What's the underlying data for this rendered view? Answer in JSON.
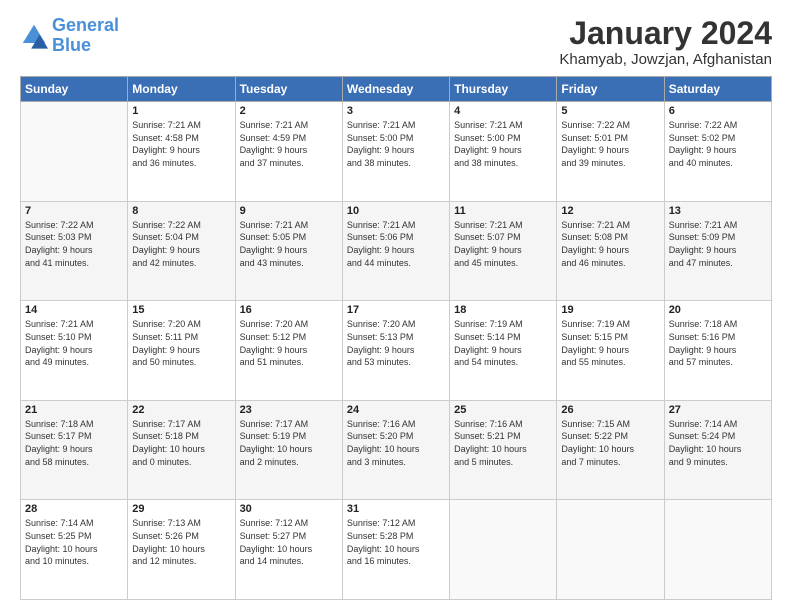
{
  "header": {
    "logo_general": "General",
    "logo_blue": "Blue",
    "title": "January 2024",
    "subtitle": "Khamyab, Jowzjan, Afghanistan"
  },
  "weekdays": [
    "Sunday",
    "Monday",
    "Tuesday",
    "Wednesday",
    "Thursday",
    "Friday",
    "Saturday"
  ],
  "weeks": [
    [
      {
        "day": "",
        "info": ""
      },
      {
        "day": "1",
        "info": "Sunrise: 7:21 AM\nSunset: 4:58 PM\nDaylight: 9 hours\nand 36 minutes."
      },
      {
        "day": "2",
        "info": "Sunrise: 7:21 AM\nSunset: 4:59 PM\nDaylight: 9 hours\nand 37 minutes."
      },
      {
        "day": "3",
        "info": "Sunrise: 7:21 AM\nSunset: 5:00 PM\nDaylight: 9 hours\nand 38 minutes."
      },
      {
        "day": "4",
        "info": "Sunrise: 7:21 AM\nSunset: 5:00 PM\nDaylight: 9 hours\nand 38 minutes."
      },
      {
        "day": "5",
        "info": "Sunrise: 7:22 AM\nSunset: 5:01 PM\nDaylight: 9 hours\nand 39 minutes."
      },
      {
        "day": "6",
        "info": "Sunrise: 7:22 AM\nSunset: 5:02 PM\nDaylight: 9 hours\nand 40 minutes."
      }
    ],
    [
      {
        "day": "7",
        "info": "Sunrise: 7:22 AM\nSunset: 5:03 PM\nDaylight: 9 hours\nand 41 minutes."
      },
      {
        "day": "8",
        "info": "Sunrise: 7:22 AM\nSunset: 5:04 PM\nDaylight: 9 hours\nand 42 minutes."
      },
      {
        "day": "9",
        "info": "Sunrise: 7:21 AM\nSunset: 5:05 PM\nDaylight: 9 hours\nand 43 minutes."
      },
      {
        "day": "10",
        "info": "Sunrise: 7:21 AM\nSunset: 5:06 PM\nDaylight: 9 hours\nand 44 minutes."
      },
      {
        "day": "11",
        "info": "Sunrise: 7:21 AM\nSunset: 5:07 PM\nDaylight: 9 hours\nand 45 minutes."
      },
      {
        "day": "12",
        "info": "Sunrise: 7:21 AM\nSunset: 5:08 PM\nDaylight: 9 hours\nand 46 minutes."
      },
      {
        "day": "13",
        "info": "Sunrise: 7:21 AM\nSunset: 5:09 PM\nDaylight: 9 hours\nand 47 minutes."
      }
    ],
    [
      {
        "day": "14",
        "info": "Sunrise: 7:21 AM\nSunset: 5:10 PM\nDaylight: 9 hours\nand 49 minutes."
      },
      {
        "day": "15",
        "info": "Sunrise: 7:20 AM\nSunset: 5:11 PM\nDaylight: 9 hours\nand 50 minutes."
      },
      {
        "day": "16",
        "info": "Sunrise: 7:20 AM\nSunset: 5:12 PM\nDaylight: 9 hours\nand 51 minutes."
      },
      {
        "day": "17",
        "info": "Sunrise: 7:20 AM\nSunset: 5:13 PM\nDaylight: 9 hours\nand 53 minutes."
      },
      {
        "day": "18",
        "info": "Sunrise: 7:19 AM\nSunset: 5:14 PM\nDaylight: 9 hours\nand 54 minutes."
      },
      {
        "day": "19",
        "info": "Sunrise: 7:19 AM\nSunset: 5:15 PM\nDaylight: 9 hours\nand 55 minutes."
      },
      {
        "day": "20",
        "info": "Sunrise: 7:18 AM\nSunset: 5:16 PM\nDaylight: 9 hours\nand 57 minutes."
      }
    ],
    [
      {
        "day": "21",
        "info": "Sunrise: 7:18 AM\nSunset: 5:17 PM\nDaylight: 9 hours\nand 58 minutes."
      },
      {
        "day": "22",
        "info": "Sunrise: 7:17 AM\nSunset: 5:18 PM\nDaylight: 10 hours\nand 0 minutes."
      },
      {
        "day": "23",
        "info": "Sunrise: 7:17 AM\nSunset: 5:19 PM\nDaylight: 10 hours\nand 2 minutes."
      },
      {
        "day": "24",
        "info": "Sunrise: 7:16 AM\nSunset: 5:20 PM\nDaylight: 10 hours\nand 3 minutes."
      },
      {
        "day": "25",
        "info": "Sunrise: 7:16 AM\nSunset: 5:21 PM\nDaylight: 10 hours\nand 5 minutes."
      },
      {
        "day": "26",
        "info": "Sunrise: 7:15 AM\nSunset: 5:22 PM\nDaylight: 10 hours\nand 7 minutes."
      },
      {
        "day": "27",
        "info": "Sunrise: 7:14 AM\nSunset: 5:24 PM\nDaylight: 10 hours\nand 9 minutes."
      }
    ],
    [
      {
        "day": "28",
        "info": "Sunrise: 7:14 AM\nSunset: 5:25 PM\nDaylight: 10 hours\nand 10 minutes."
      },
      {
        "day": "29",
        "info": "Sunrise: 7:13 AM\nSunset: 5:26 PM\nDaylight: 10 hours\nand 12 minutes."
      },
      {
        "day": "30",
        "info": "Sunrise: 7:12 AM\nSunset: 5:27 PM\nDaylight: 10 hours\nand 14 minutes."
      },
      {
        "day": "31",
        "info": "Sunrise: 7:12 AM\nSunset: 5:28 PM\nDaylight: 10 hours\nand 16 minutes."
      },
      {
        "day": "",
        "info": ""
      },
      {
        "day": "",
        "info": ""
      },
      {
        "day": "",
        "info": ""
      }
    ]
  ]
}
